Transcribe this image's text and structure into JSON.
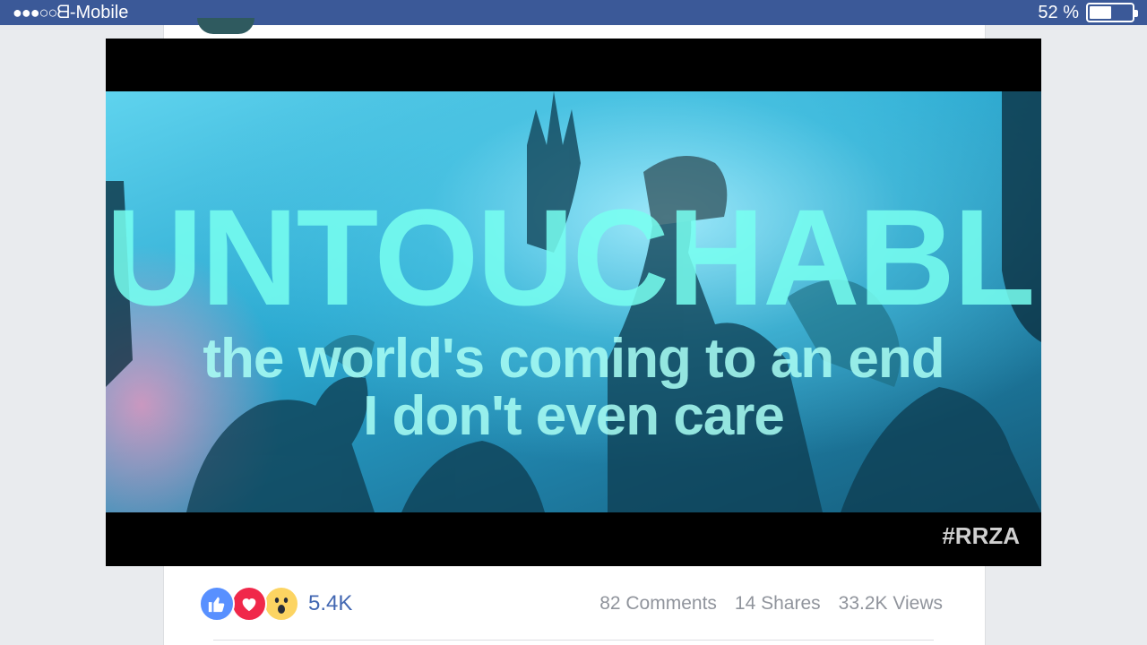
{
  "status_bar": {
    "signal_dots": "●●●○○",
    "carrier": "ᗺ-Mobile",
    "battery_percent_text": "52 %",
    "battery_level": 0.52
  },
  "video": {
    "title": "UNTOUCHABLE",
    "lyric_line_1": "the world's coming to an end",
    "lyric_line_2": "I don't even care",
    "watermark": "#RRZA"
  },
  "post_footer": {
    "reaction_icons": [
      "like-icon",
      "love-icon",
      "wow-icon"
    ],
    "reaction_count": "5.4K",
    "comments": "82 Comments",
    "shares": "14 Shares",
    "views": "33.2K Views"
  },
  "colors": {
    "status_bar_bg": "#3b5998",
    "link_blue": "#4267b2",
    "like_blue": "#5890ff",
    "love_red": "#f0284a",
    "wow_yellow": "#fcd462",
    "meta_gray": "#90949c"
  }
}
